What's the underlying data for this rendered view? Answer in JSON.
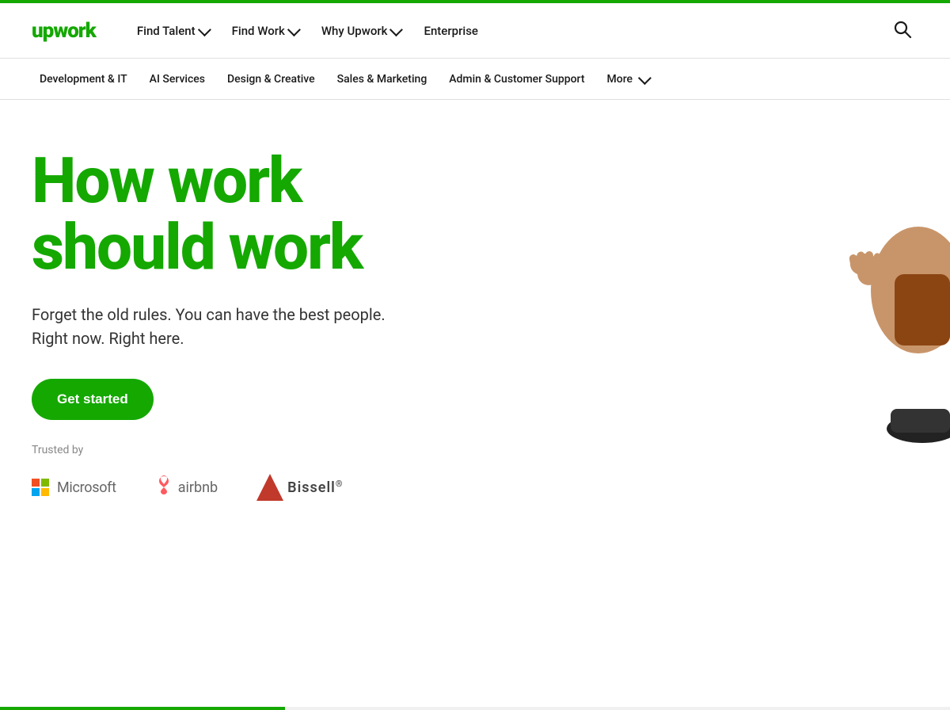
{
  "topbar": {
    "color": "#14a800"
  },
  "primary_nav": {
    "logo": "upwork",
    "links": [
      {
        "id": "find-talent",
        "label": "Find Talent",
        "has_dropdown": true
      },
      {
        "id": "find-work",
        "label": "Find Work",
        "has_dropdown": true
      },
      {
        "id": "why-upwork",
        "label": "Why Upwork",
        "has_dropdown": true
      },
      {
        "id": "enterprise",
        "label": "Enterprise",
        "has_dropdown": false
      }
    ],
    "search_icon_label": "search"
  },
  "secondary_nav": {
    "links": [
      {
        "id": "dev-it",
        "label": "Development & IT"
      },
      {
        "id": "ai-services",
        "label": "AI Services"
      },
      {
        "id": "design-creative",
        "label": "Design & Creative"
      },
      {
        "id": "sales-marketing",
        "label": "Sales & Marketing"
      },
      {
        "id": "admin-support",
        "label": "Admin & Customer Support"
      },
      {
        "id": "more",
        "label": "More",
        "has_dropdown": true
      }
    ]
  },
  "hero": {
    "heading_line1": "How work",
    "heading_line2": "should work",
    "subheading_line1": "Forget the old rules. You can have the best people.",
    "subheading_line2": "Right now. Right here.",
    "cta_label": "Get started"
  },
  "trusted_section": {
    "label": "Trusted by",
    "logos": [
      {
        "id": "microsoft",
        "name": "Microsoft"
      },
      {
        "id": "airbnb",
        "name": "airbnb"
      },
      {
        "id": "bissell",
        "name": "Bissell"
      }
    ]
  }
}
